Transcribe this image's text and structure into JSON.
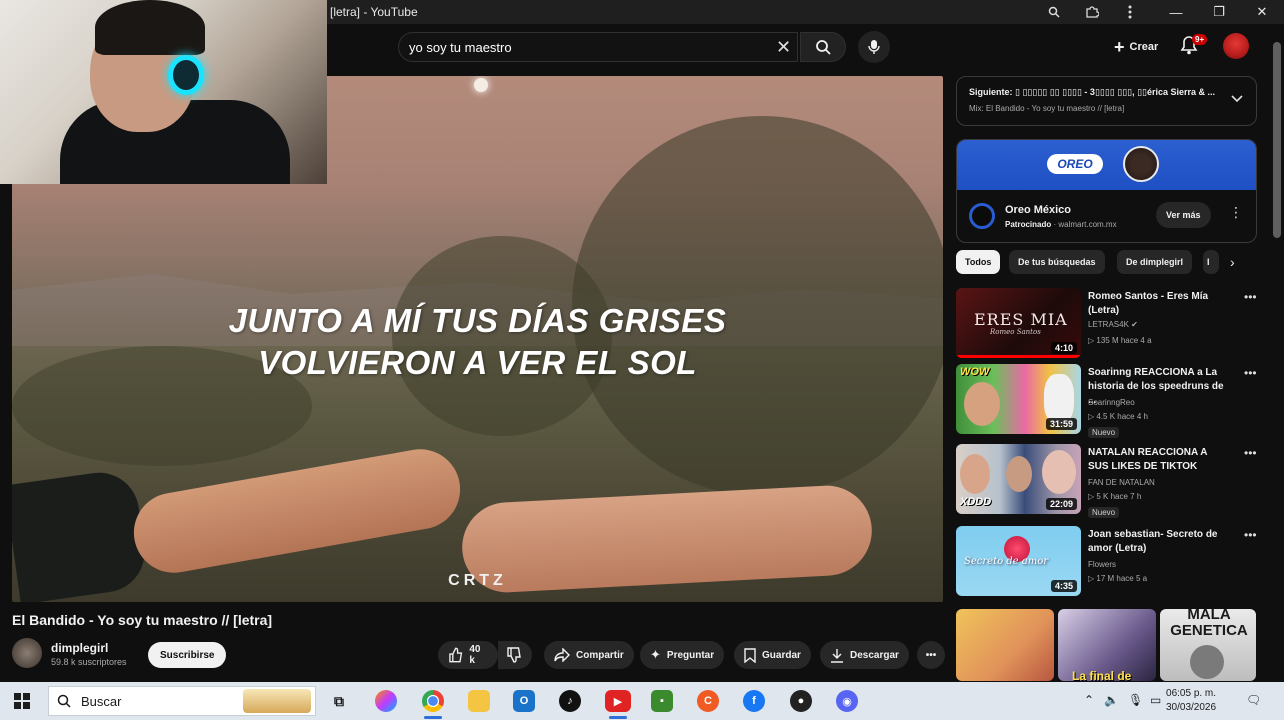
{
  "window": {
    "title": "[letra] - YouTube",
    "zoom_icon": "zoom-icon",
    "extensions_icon": "puzzle-icon",
    "menu_icon": "more-vert-icon",
    "minimize": "—",
    "maximize": "❐",
    "close": "✕"
  },
  "topbar": {
    "search_value": "yo soy tu maestro",
    "clear": "✕",
    "create_label": "Crear",
    "notifications_badge": "9+"
  },
  "player": {
    "lyric_line1": "JUNTO A MÍ TUS DÍAS GRISES",
    "lyric_line2": "VOLVIERON A VER EL SOL",
    "watermark": "CRTZ"
  },
  "video": {
    "title": "El Bandido - Yo soy tu maestro // [letra]",
    "channel": "dimplegirl",
    "subscribers": "59.8 k suscriptores",
    "subscribe_label": "Suscribirse",
    "likes": "40 k",
    "share_label": "Compartir",
    "ask_label": "Preguntar",
    "save_label": "Guardar",
    "download_label": "Descargar",
    "more": "•••"
  },
  "up_next": {
    "label": "Siguiente: ▯ ▯▯▯▯▯ ▯▯ ▯▯▯▯ - 3▯▯▯▯ ▯▯▯, ▯▯érica Sierra & ...",
    "mix": "Mix: El Bandido - Yo soy tu maestro // [letra]"
  },
  "ad": {
    "logo": "OREO",
    "title": "Oreo México",
    "sponsored": "Patrocinado",
    "domain": "· walmart.com.mx",
    "cta": "Ver más"
  },
  "chips": [
    "Todos",
    "De tus búsquedas",
    "De dimplegirl",
    "I"
  ],
  "recommendations": [
    {
      "title": "Romeo Santos - Eres Mía (Letra)",
      "channel": "LETRAS4K ✔",
      "meta": "▷ 135 M   hace 4 a",
      "duration": "4:10",
      "thumb_text": "ERES MIA",
      "thumb_sub": "Romeo Santos",
      "badge": ""
    },
    {
      "title": "Soarinng REACCIONA a La historia de los speedruns de ...",
      "channel": "SoarinngReo",
      "meta": "▷ 4.5 K   hace 4 h",
      "duration": "31:59",
      "thumb_text": "WOW",
      "badge": "Nuevo"
    },
    {
      "title": "NATALAN REACCIONA A SUS LIKES DE TIKTOK",
      "channel": "FAN DE NATALAN",
      "meta": "▷ 5 K   hace 7 h",
      "duration": "22:09",
      "thumb_text": "XDDD",
      "badge": "Nuevo"
    },
    {
      "title": "Joan sebastian- Secreto de amor (Letra)",
      "channel": "Flowers",
      "meta": "▷ 17 M   hace 5 a",
      "duration": "4:35",
      "thumb_text": "Secreto de amor",
      "badge": ""
    }
  ],
  "shorts": [
    {
      "text": ""
    },
    {
      "text": "La final de"
    },
    {
      "text": "MALA GENETICA"
    }
  ],
  "taskbar": {
    "search_placeholder": "Buscar",
    "time": "06:05 p. m.",
    "date": "30/03/2026"
  }
}
